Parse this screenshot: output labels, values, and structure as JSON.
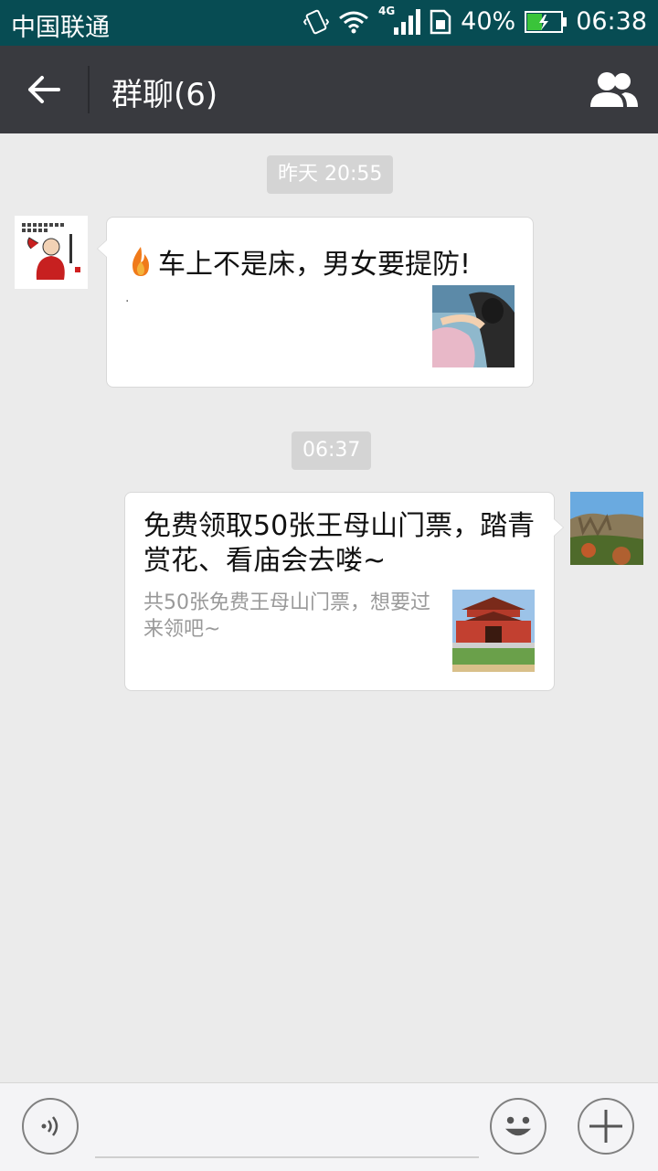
{
  "status_bar": {
    "carrier": "中国联通",
    "network": "4G",
    "battery": "40%",
    "time": "06:38"
  },
  "header": {
    "title": "群聊(6)"
  },
  "messages": [
    {
      "timestamp": "昨天 20:55",
      "side": "left",
      "title": "车上不是床，男女要提防!",
      "dot": "."
    },
    {
      "timestamp": "06:37",
      "side": "right",
      "title": "免费领取50张王母山门票，踏青赏花、看庙会去喽~",
      "description": "共50张免费王母山门票，想要过来领吧~"
    }
  ],
  "input_bar": {
    "message_value": ""
  },
  "colors": {
    "status_bar_bg": "#074c53",
    "title_bar_bg": "#393a3f",
    "chat_bg": "#ebebeb",
    "timestamp_bg": "#d4d4d4",
    "battery_fill": "#3ac43a"
  },
  "icons": [
    "vibrate-icon",
    "wifi-icon",
    "signal-icon",
    "sim-icon",
    "battery-icon",
    "back-arrow-icon",
    "group-members-icon",
    "fire-icon",
    "voice-icon",
    "emoji-icon",
    "plus-icon"
  ]
}
